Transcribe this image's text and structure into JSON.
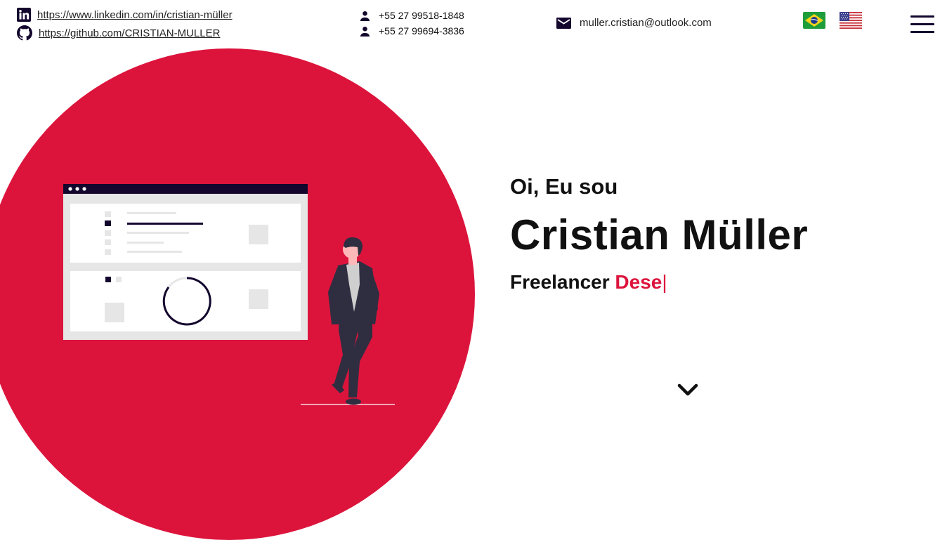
{
  "header": {
    "linkedin": {
      "icon": "linkedin-icon",
      "url": "https://www.linkedin.com/in/cristian-müller"
    },
    "github": {
      "icon": "github-icon",
      "url": "https://github.com/CRISTIAN-MULLER"
    },
    "phones": [
      {
        "icon": "person-icon",
        "number": "+55 27 99518-1848"
      },
      {
        "icon": "person-icon",
        "number": "+55 27 99694-3836"
      }
    ],
    "email": {
      "icon": "envelope-icon",
      "address": "muller.cristian@outlook.com"
    },
    "languages": [
      {
        "icon": "brazil-flag-icon"
      },
      {
        "icon": "usa-flag-icon"
      }
    ],
    "menu_icon": "hamburger-menu-icon"
  },
  "hero": {
    "greeting": "Oi, Eu sou",
    "name": "Cristian Müller",
    "role_prefix": "Freelancer",
    "role_typed": "Dese",
    "caret": "|",
    "scroll_icon": "chevron-down-icon"
  },
  "colors": {
    "accent": "#dc143c",
    "dark": "#14072e",
    "text": "#111111"
  }
}
